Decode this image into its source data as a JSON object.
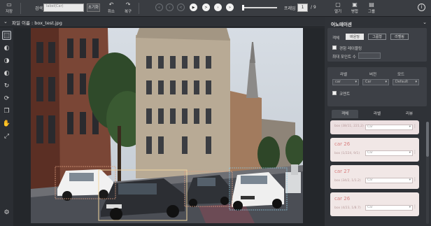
{
  "toolbar": {
    "save_label": "저장",
    "search_label": "검색",
    "search_placeholder": "label(Car)",
    "search_button": "초기화",
    "undo_label": "취소",
    "redo_label": "복구",
    "playback": [
      "«",
      "‹",
      "<",
      "▶",
      ">",
      "›",
      "»"
    ],
    "frame_label": "프레임",
    "frame_value": "1",
    "frame_total": "/ 9",
    "open_label": "열기",
    "grid_label": "병합",
    "group_label": "그룹",
    "info_icon": "info-icon"
  },
  "file": {
    "name": "파일 이름 : box_test.jpg"
  },
  "tools": [
    "select-icon",
    "rect-icon",
    "polygon-icon",
    "brush-icon",
    "rotate-icon",
    "redo-icon",
    "layer-icon",
    "hand-icon",
    "fit-icon",
    "settings-icon"
  ],
  "panel": {
    "title": "어노테이션",
    "type_label": "객체",
    "type_options": [
      "바운딩",
      "그룹형",
      "라벨링"
    ],
    "type_selected": 0,
    "show_label": "경험 레이블링",
    "min_points_label": "최대 포인트 수",
    "row_headers": [
      "라벨",
      "버전",
      "모드"
    ],
    "row_values": [
      "car",
      "Car",
      "Default"
    ],
    "comment_label": "코멘트",
    "tabs": [
      "객체",
      "라벨",
      "리뷰"
    ],
    "active_tab": 0,
    "objects": [
      {
        "name": "",
        "coords": "box (38/11, 221.2)",
        "class": "Car"
      },
      {
        "name": "car 26",
        "coords": "box (1/224, 9/1)",
        "class": "Car"
      },
      {
        "name": "car 27",
        "coords": "box (34/2, 1/1.2)",
        "class": "Car"
      },
      {
        "name": "car 26",
        "coords": "box (4/23, 1/8.7)",
        "class": "Car"
      }
    ]
  },
  "colors": {
    "bg": "#2b2e33",
    "accent": "#e8e8e8",
    "label_text": "#d98080",
    "box_color": "#f1d5a0"
  }
}
